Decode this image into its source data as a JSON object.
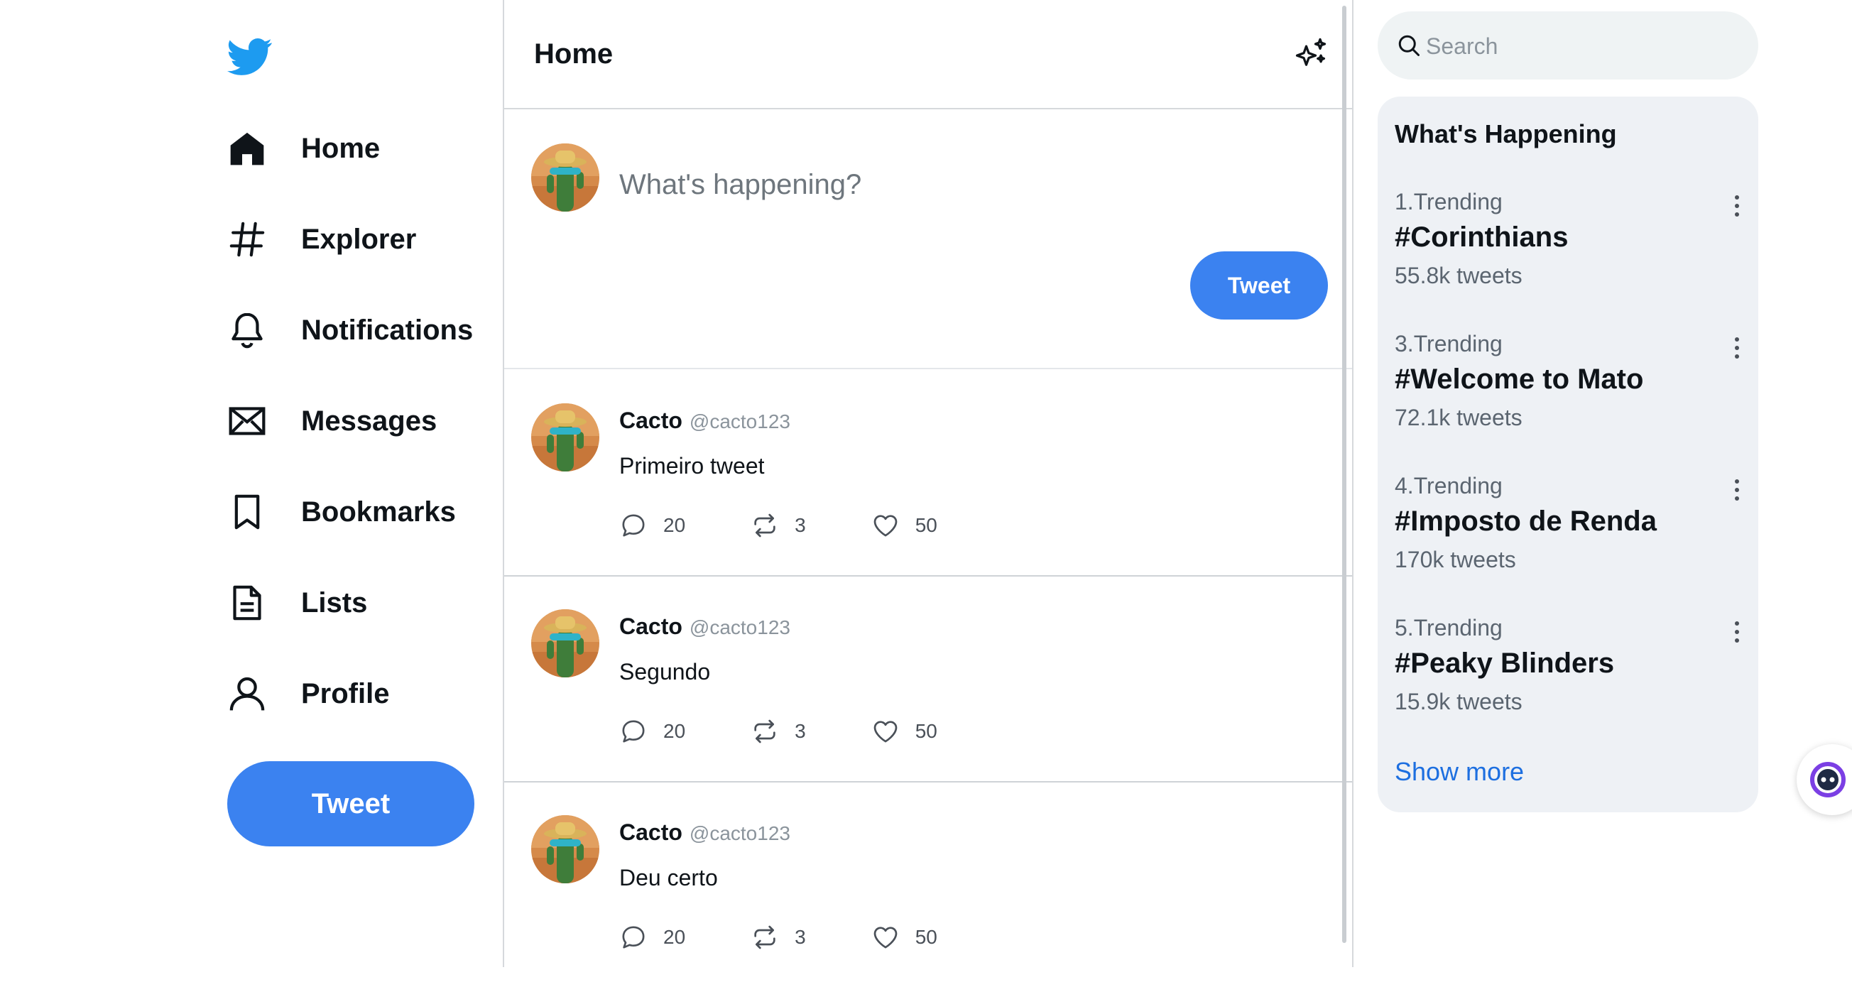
{
  "colors": {
    "accent": "#3b82f0",
    "twitter_blue": "#1d9bf0",
    "link": "#1d6fe0",
    "panel": "#eef1f5"
  },
  "sidebar": {
    "logo_icon": "twitter-bird-icon",
    "items": [
      {
        "label": "Home",
        "icon": "home-icon"
      },
      {
        "label": "Explorer",
        "icon": "hashtag-icon"
      },
      {
        "label": "Notifications",
        "icon": "bell-icon"
      },
      {
        "label": "Messages",
        "icon": "envelope-icon"
      },
      {
        "label": "Bookmarks",
        "icon": "bookmark-icon"
      },
      {
        "label": "Lists",
        "icon": "list-document-icon"
      },
      {
        "label": "Profile",
        "icon": "user-icon"
      }
    ],
    "tweet_button": "Tweet"
  },
  "main": {
    "title": "Home",
    "composer": {
      "placeholder": "What's happening?",
      "button": "Tweet"
    },
    "tweets": [
      {
        "name": "Cacto",
        "handle": "@cacto123",
        "text": "Primeiro tweet",
        "replies": "20",
        "retweets": "3",
        "likes": "50"
      },
      {
        "name": "Cacto",
        "handle": "@cacto123",
        "text": "Segundo",
        "replies": "20",
        "retweets": "3",
        "likes": "50"
      },
      {
        "name": "Cacto",
        "handle": "@cacto123",
        "text": "Deu certo",
        "replies": "20",
        "retweets": "3",
        "likes": "50"
      }
    ]
  },
  "right": {
    "search_placeholder": "Search",
    "trends_title": "What's Happening",
    "trends": [
      {
        "rank": "1.Trending",
        "tag": "#Corinthians",
        "count": "55.8k tweets"
      },
      {
        "rank": "3.Trending",
        "tag": "#Welcome to Mato",
        "count": "72.1k tweets"
      },
      {
        "rank": "4.Trending",
        "tag": "#Imposto de Renda",
        "count": "170k tweets"
      },
      {
        "rank": "5.Trending",
        "tag": "#Peaky Blinders",
        "count": "15.9k tweets"
      }
    ],
    "show_more": "Show more"
  }
}
